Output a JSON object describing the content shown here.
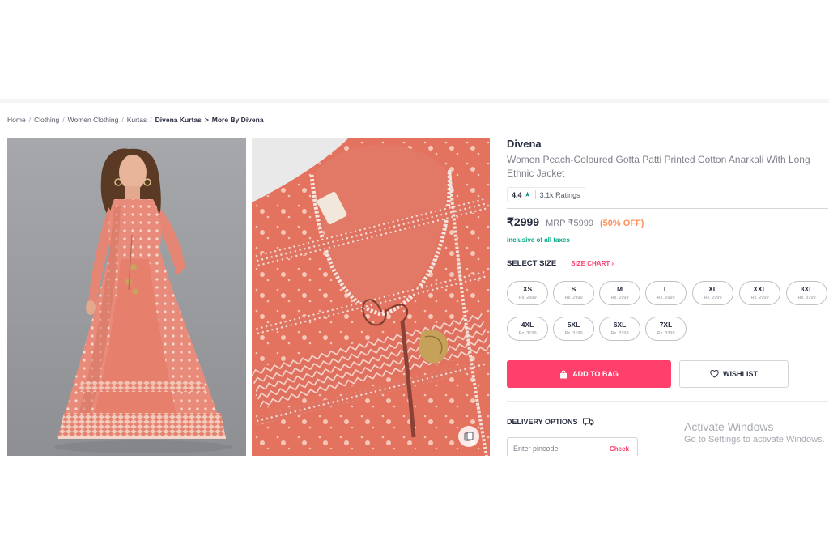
{
  "breadcrumb": [
    {
      "label": "Home",
      "bold": false
    },
    {
      "label": "Clothing",
      "bold": false
    },
    {
      "label": "Women Clothing",
      "bold": false
    },
    {
      "label": "Kurtas",
      "bold": false
    },
    {
      "label": "Divena Kurtas",
      "bold": true
    },
    {
      "label": "More By Divena",
      "bold": true
    }
  ],
  "product": {
    "brand": "Divena",
    "name": "Women Peach-Coloured Gotta Patti Printed Cotton Anarkali With Long Ethnic Jacket",
    "rating": "4.4",
    "rating_count": "3.1k Ratings",
    "price": "₹2999",
    "mrp_label": "MRP",
    "mrp": "₹5999",
    "discount": "(50% OFF)",
    "taxes_note": "inclusive of all taxes"
  },
  "sizes": {
    "title": "SELECT SIZE",
    "chart_link": "SIZE CHART",
    "options": [
      {
        "size": "XS",
        "price": "Rs. 2999"
      },
      {
        "size": "S",
        "price": "Rs. 2999"
      },
      {
        "size": "M",
        "price": "Rs. 2999"
      },
      {
        "size": "L",
        "price": "Rs. 2999"
      },
      {
        "size": "XL",
        "price": "Rs. 2999"
      },
      {
        "size": "XXL",
        "price": "Rs. 2999"
      },
      {
        "size": "3XL",
        "price": "Rs. 3199"
      },
      {
        "size": "4XL",
        "price": "Rs. 3199"
      },
      {
        "size": "5XL",
        "price": "Rs. 3199"
      },
      {
        "size": "6XL",
        "price": "Rs. 3399"
      },
      {
        "size": "7XL",
        "price": "Rs. 3399"
      }
    ]
  },
  "actions": {
    "add_to_bag": "ADD TO BAG",
    "wishlist": "WISHLIST"
  },
  "delivery": {
    "title": "DELIVERY OPTIONS",
    "pincode_placeholder": "Enter pincode",
    "check": "Check"
  },
  "watermark": {
    "line1": "Activate Windows",
    "line2": "Go to Settings to activate Windows."
  },
  "colors": {
    "accent": "#ff3f6c",
    "discount": "#ff905a",
    "rating_star": "#14958f",
    "tax_note": "#03a685"
  },
  "icons": {
    "add_to_bag": "bag-icon",
    "wishlist": "heart-icon",
    "delivery": "truck-icon",
    "size_chart": "chevron-right-icon",
    "similar": "similar-products-icon"
  }
}
